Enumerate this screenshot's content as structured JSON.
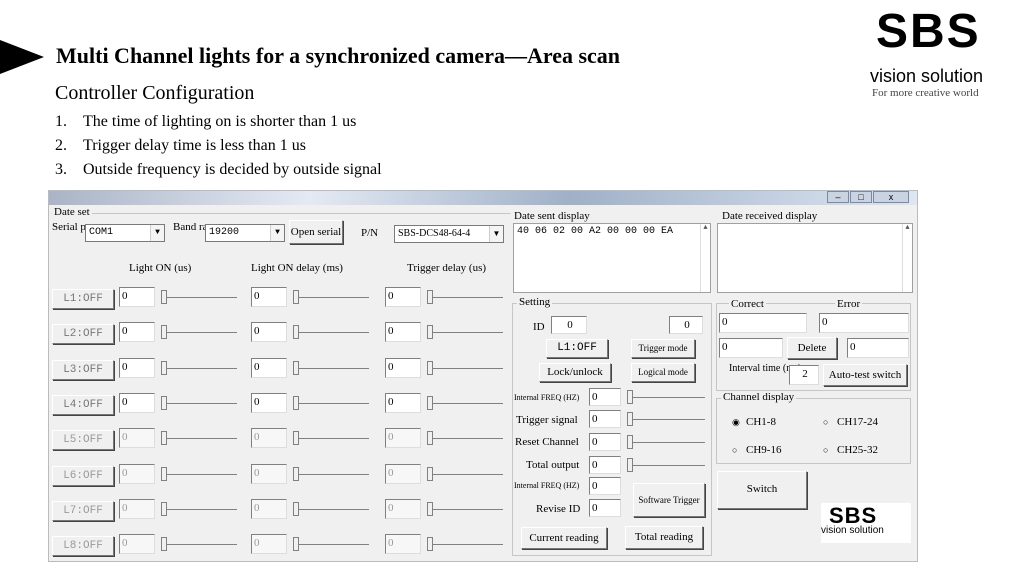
{
  "slide": {
    "title": "Multi Channel lights for a synchronized  camera—Area scan",
    "subtitle": "Controller Configuration",
    "points": [
      {
        "num": "1.",
        "text": "The time of lighting on is shorter than 1 us"
      },
      {
        "num": "2.",
        "text": "Trigger delay time is less than 1 us"
      },
      {
        "num": "3.",
        "text": "Outside frequency is decided by outside signal"
      }
    ],
    "logo": {
      "mark": "SBS",
      "name": "vision solution",
      "tagline": "For more creative world"
    }
  },
  "window": {
    "buttons": {
      "minimize": "–",
      "maximize": "□",
      "close": "x"
    },
    "date_set": {
      "label": "Date set",
      "serial_port_label": "Serial port",
      "serial_port_value": "COM1",
      "band_rate_label": "Band rate",
      "band_rate_value": "19200",
      "open_serial": "Open serial",
      "pn_label": "P/N",
      "pn_value": "SBS-DCS48-64-4"
    },
    "columns": {
      "light_on": "Light ON (us)",
      "light_on_delay": "Light ON delay (ms)",
      "trigger_delay": "Trigger delay (us)"
    },
    "channels": [
      {
        "button": "L1:OFF",
        "light_on": "0",
        "light_on_delay": "0",
        "trigger_delay": "0",
        "enabled": true
      },
      {
        "button": "L2:OFF",
        "light_on": "0",
        "light_on_delay": "0",
        "trigger_delay": "0",
        "enabled": true
      },
      {
        "button": "L3:OFF",
        "light_on": "0",
        "light_on_delay": "0",
        "trigger_delay": "0",
        "enabled": true
      },
      {
        "button": "L4:OFF",
        "light_on": "0",
        "light_on_delay": "0",
        "trigger_delay": "0",
        "enabled": true
      },
      {
        "button": "L5:OFF",
        "light_on": "0",
        "light_on_delay": "0",
        "trigger_delay": "0",
        "enabled": false
      },
      {
        "button": "L6:OFF",
        "light_on": "0",
        "light_on_delay": "0",
        "trigger_delay": "0",
        "enabled": false
      },
      {
        "button": "L7:OFF",
        "light_on": "0",
        "light_on_delay": "0",
        "trigger_delay": "0",
        "enabled": false
      },
      {
        "button": "L8:OFF",
        "light_on": "0",
        "light_on_delay": "0",
        "trigger_delay": "0",
        "enabled": false
      }
    ],
    "sent_display": {
      "label": "Date sent display",
      "content": "40 06 02 00 A2 00 00 00 EA"
    },
    "received_display": {
      "label": "Date received display",
      "content": ""
    },
    "setting": {
      "label": "Setting",
      "id_label": "ID",
      "id_value": "0",
      "id_value2": "0",
      "l1_button": "L1:OFF",
      "trigger_mode": "Trigger mode",
      "lock_unlock": "Lock/unlock",
      "logical_mode": "Logical mode",
      "internal_freq_label": "Internal FREQ (HZ)",
      "internal_freq_value": "0",
      "trigger_signal_label": "Trigger signal",
      "trigger_signal_value": "0",
      "reset_channel_label": "Reset Channel",
      "reset_channel_value": "0",
      "total_output_label": "Total output",
      "total_output_value": "0",
      "internal_freq2_label": "Internal FREQ (HZ)",
      "internal_freq2_value": "0",
      "software_trigger": "Software Trigger",
      "revise_id_label": "Revise ID",
      "revise_id_value": "0",
      "current_reading": "Current reading",
      "total_reading": "Total reading"
    },
    "stats": {
      "correct_label": "Correct",
      "error_label": "Error",
      "correct_value": "0",
      "error_value": "0",
      "value3": "0",
      "delete": "Delete",
      "value4": "0",
      "interval_label": "Interval time (ms)",
      "interval_value": "2",
      "auto_test": "Auto-test switch"
    },
    "channel_display": {
      "label": "Channel display",
      "options": [
        {
          "label": "CH1-8",
          "checked": true
        },
        {
          "label": "CH17-24",
          "checked": false
        },
        {
          "label": "CH9-16",
          "checked": false
        },
        {
          "label": "CH25-32",
          "checked": false
        }
      ],
      "switch": "Switch"
    },
    "small_logo": {
      "mark": "SBS",
      "name": "vision solution"
    }
  }
}
